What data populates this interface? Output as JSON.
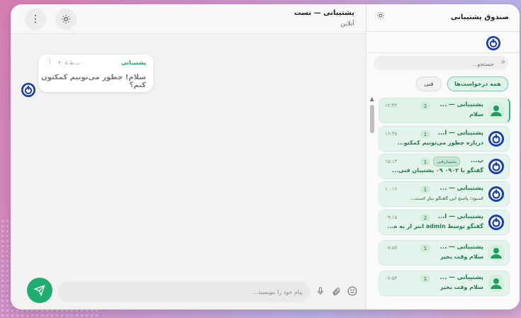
{
  "chat": {
    "title": "پشتیبانی — تست",
    "status": "آنلاین",
    "message": {
      "sender": "پشتیبانی",
      "time": "۴:۰۵ ب.ظ",
      "text": "سلام! چطور می‌تونیم کمکتون کنم؟"
    },
    "composer_placeholder": "پیام خود را بنویسید..."
  },
  "sidebar": {
    "title": "صندوق پشتیبانی",
    "search_placeholder": "جستجو...",
    "tabs": [
      {
        "label": "همه درخواست‌ها",
        "active": true
      },
      {
        "label": "فنی",
        "active": false
      }
    ],
    "conversations": [
      {
        "title": "پشتیبانی — ...",
        "preview": "سلام",
        "count": "2",
        "time": "۱۲:۳۲",
        "avatar": "person",
        "selected": true
      },
      {
        "title": "پشتیبانی — ا...",
        "preview": "درباره چطور می‌تونیم کمکتو...",
        "count": "1",
        "time": "۱۶:۳۸",
        "avatar": "logo"
      },
      {
        "title": "پ...",
        "badge": "پشتیبان‌فنی",
        "preview": "گفتگو با ۰۹۰۲ ۰۹ پشتیبان فنی...",
        "count": "1",
        "time": "۱۵:۱۳",
        "avatar": "logo"
      },
      {
        "title": "پشتیبانی — ...",
        "preview": "کمبود: پاسخ این گفتگو نیاز است...",
        "small": true,
        "count": "1",
        "time": "۱۰:۱۶",
        "avatar": "logo"
      },
      {
        "title": "پشتیبانی — ا...",
        "preview": "گفتگو توسط admin انتر از به ه...",
        "count": "2",
        "time": "۰۹:۱۵",
        "avatar": "logo"
      },
      {
        "title": "پشتیبانی — ...",
        "preview": "سلام وقت بخیر",
        "count": "1",
        "time": "۰۷:۵۷",
        "avatar": "person"
      },
      {
        "title": "پشتیبانی — ...",
        "preview": "سلام وقت بخیر",
        "count": "1",
        "time": "۰۷:۵۴",
        "avatar": "person"
      }
    ]
  },
  "colors": {
    "accent": "#1fae6f",
    "logo_blue": "#1d3fa8"
  },
  "icons": {
    "menu": "more-vertical-icon",
    "theme": "sun-icon",
    "send": "send-icon",
    "mic": "mic-icon",
    "attach": "paperclip-icon",
    "emoji": "emoji-icon",
    "search": "search-icon"
  }
}
